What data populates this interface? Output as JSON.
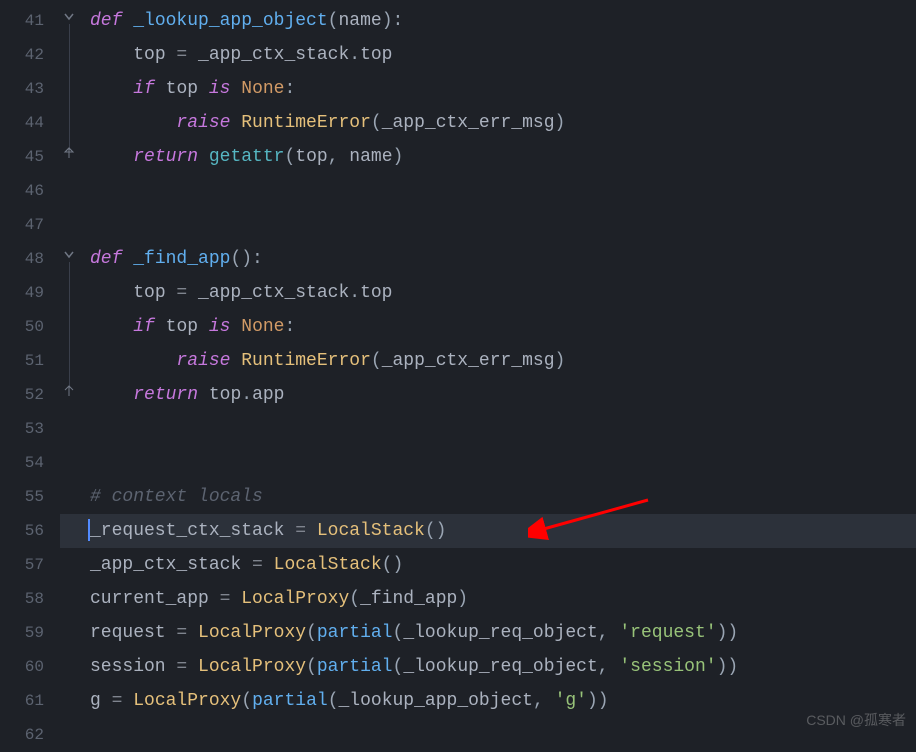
{
  "lines": [
    {
      "num": "41",
      "fold_open": true
    },
    {
      "num": "42"
    },
    {
      "num": "43"
    },
    {
      "num": "44"
    },
    {
      "num": "45",
      "fold_close": true
    },
    {
      "num": "46"
    },
    {
      "num": "47"
    },
    {
      "num": "48",
      "fold_open": true
    },
    {
      "num": "49"
    },
    {
      "num": "50"
    },
    {
      "num": "51"
    },
    {
      "num": "52",
      "fold_close": true
    },
    {
      "num": "53"
    },
    {
      "num": "54"
    },
    {
      "num": "55"
    },
    {
      "num": "56",
      "highlighted": true
    },
    {
      "num": "57"
    },
    {
      "num": "58"
    },
    {
      "num": "59"
    },
    {
      "num": "60"
    },
    {
      "num": "61"
    },
    {
      "num": "62"
    }
  ],
  "code": {
    "l41": {
      "kw_def": "def",
      "fn": "_lookup_app_object",
      "p1": "(",
      "arg": "name",
      "p2": "):"
    },
    "l42": {
      "v": "top",
      "eq": " = ",
      "obj": "_app_ctx_stack",
      "dot": ".",
      "prop": "top"
    },
    "l43": {
      "kw_if": "if",
      "v": "top",
      "kw_is": "is",
      "none": "None",
      "colon": ":"
    },
    "l44": {
      "kw_raise": "raise",
      "cls": "RuntimeError",
      "p1": "(",
      "arg": "_app_ctx_err_msg",
      "p2": ")"
    },
    "l45": {
      "kw_return": "return",
      "fn": "getattr",
      "p1": "(",
      "a1": "top",
      "c": ",",
      "a2": " name",
      "p2": ")"
    },
    "l48": {
      "kw_def": "def",
      "fn": "_find_app",
      "p1": "():",
      "arg": ""
    },
    "l49": {
      "v": "top",
      "eq": " = ",
      "obj": "_app_ctx_stack",
      "dot": ".",
      "prop": "top"
    },
    "l50": {
      "kw_if": "if",
      "v": "top",
      "kw_is": "is",
      "none": "None",
      "colon": ":"
    },
    "l51": {
      "kw_raise": "raise",
      "cls": "RuntimeError",
      "p1": "(",
      "arg": "_app_ctx_err_msg",
      "p2": ")"
    },
    "l52": {
      "kw_return": "return",
      "v": "top",
      "dot": ".",
      "prop": "app"
    },
    "l55": {
      "comment": "# context locals"
    },
    "l56": {
      "v": "_request_ctx_stack",
      "eq": " = ",
      "cls": "LocalStack",
      "p": "()"
    },
    "l57": {
      "v": "_app_ctx_stack",
      "eq": " = ",
      "cls": "LocalStack",
      "p": "()"
    },
    "l58": {
      "v": "current_app",
      "eq": " = ",
      "cls": "LocalProxy",
      "p1": "(",
      "arg": "_find_app",
      "p2": ")"
    },
    "l59": {
      "v": "request",
      "eq": " = ",
      "cls": "LocalProxy",
      "p1": "(",
      "fn": "partial",
      "p2": "(",
      "a1": "_lookup_req_object",
      "c": ",",
      "s": "'request'",
      "p3": "))"
    },
    "l60": {
      "v": "session",
      "eq": " = ",
      "cls": "LocalProxy",
      "p1": "(",
      "fn": "partial",
      "p2": "(",
      "a1": "_lookup_req_object",
      "c": ",",
      "s": "'session'",
      "p3": "))"
    },
    "l61": {
      "v": "g",
      "eq": " = ",
      "cls": "LocalProxy",
      "p1": "(",
      "fn": "partial",
      "p2": "(",
      "a1": "_lookup_app_object",
      "c": ",",
      "s": "'g'",
      "p3": "))"
    }
  },
  "watermark": "CSDN @孤寒者"
}
